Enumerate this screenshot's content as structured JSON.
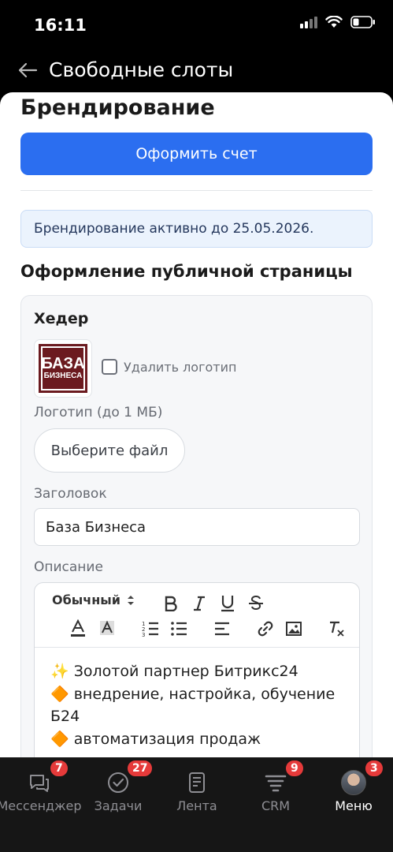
{
  "status_bar": {
    "time": "16:11"
  },
  "nav": {
    "title": "Свободные слоты"
  },
  "branding": {
    "title": "Брендирование",
    "pay_button": "Оформить счет",
    "active_notice": "Брендирование активно до 25.05.2026."
  },
  "public_page": {
    "title": "Оформление публичной страницы",
    "header_section": {
      "title": "Хедер",
      "logo_text_line1": "БАЗА",
      "logo_text_line2": "БИЗНЕСА",
      "delete_logo_label": "Удалить логотип",
      "logo_field_label": "Логотип (до 1 МБ)",
      "choose_file_button": "Выберите файл",
      "heading_label": "Заголовок",
      "heading_value": "База Бизнеса",
      "description_label": "Описание"
    },
    "editor": {
      "format_select": "Обычный",
      "toolbar_icons": [
        "bold-icon",
        "italic-icon",
        "underline-icon",
        "strikethrough-icon",
        "text-color-icon",
        "background-color-icon",
        "ordered-list-icon",
        "bullet-list-icon",
        "align-icon",
        "link-icon",
        "image-icon",
        "clear-format-icon"
      ],
      "lines": [
        "✨ Золотой партнер Битрикс24",
        "🔶 внедрение, настройка, обучение",
        "Б24",
        "🔶 автоматизация продаж"
      ]
    }
  },
  "tab_bar": {
    "tabs": [
      {
        "label": "Мессенджер",
        "icon": "chat-icon",
        "badge": "7"
      },
      {
        "label": "Задачи",
        "icon": "check-circle-icon",
        "badge": "27"
      },
      {
        "label": "Лента",
        "icon": "feed-icon",
        "badge": ""
      },
      {
        "label": "CRM",
        "icon": "crm-funnel-icon",
        "badge": "9"
      },
      {
        "label": "Меню",
        "icon": "avatar",
        "badge": "3"
      }
    ]
  },
  "colors": {
    "accent": "#2b6ef0",
    "badge": "#e53a3a",
    "logo_bg": "#6b1a1f"
  }
}
